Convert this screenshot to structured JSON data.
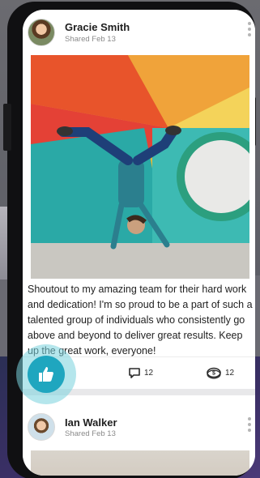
{
  "posts": [
    {
      "author": "Gracie Smith",
      "meta": "Shared Feb 13",
      "caption": "Shoutout to my amazing team for their hard work and dedication! I'm so proud to be a part of such a talented group of individuals who consistently go above and beyond to deliver great results. Keep up the great work, everyone!",
      "comments_count": "12",
      "shares_count": "12"
    },
    {
      "author": "Ian Walker",
      "meta": "Shared Feb 13"
    }
  ],
  "icons": {
    "like": "thumbs-up-icon",
    "comment": "comment-bubble-icon",
    "share": "coin-share-icon",
    "more": "more-vertical-icon"
  },
  "colors": {
    "like_button": "#1fa6bf",
    "like_ring": "#78d2dc",
    "text": "#1f1f1f",
    "meta": "#8a8a8a"
  }
}
